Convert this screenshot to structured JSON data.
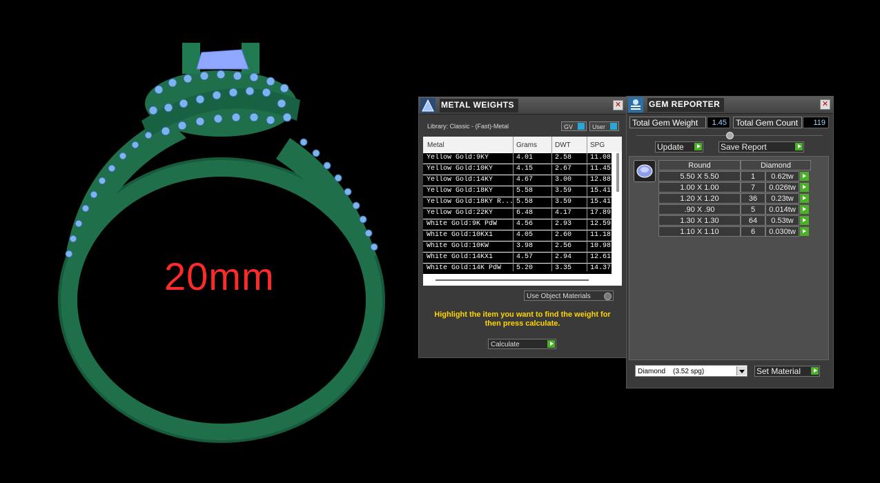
{
  "ring_view": {
    "size_label": "20mm"
  },
  "metal_weights": {
    "title": "METAL WEIGHTS",
    "library_label": "Library: Classic - (Fast)-Metal",
    "toggle_gv": "GV",
    "toggle_user": "User",
    "columns": [
      "Metal",
      "Grams",
      "DWT",
      "SPG"
    ],
    "rows": [
      [
        "Yellow Gold:9KY",
        "4.01",
        "2.58",
        "11.08"
      ],
      [
        "Yellow Gold:10KY",
        "4.15",
        "2.67",
        "11.45"
      ],
      [
        "Yellow Gold:14KY",
        "4.67",
        "3.00",
        "12.88"
      ],
      [
        "Yellow Gold:18KY",
        "5.58",
        "3.59",
        "15.41"
      ],
      [
        "Yellow Gold:18KY R...",
        "5.58",
        "3.59",
        "15.41"
      ],
      [
        "Yellow Gold:22KY",
        "6.48",
        "4.17",
        "17.89"
      ],
      [
        "White Gold:9K PdW",
        "4.56",
        "2.93",
        "12.59"
      ],
      [
        "White Gold:10KX1",
        "4.05",
        "2.60",
        "11.18"
      ],
      [
        "White Gold:10KW",
        "3.98",
        "2.56",
        "10.98"
      ],
      [
        "White Gold:14KX1",
        "4.57",
        "2.94",
        "12.61"
      ],
      [
        "White Gold:14K PdW",
        "5.20",
        "3.35",
        "14.37"
      ]
    ],
    "use_object_materials": "Use Object Materials",
    "hint": "Highlight the item you want to find the weight for then press calculate.",
    "calculate_label": "Calculate"
  },
  "gem_reporter": {
    "title": "GEM REPORTER",
    "total_weight_label": "Total Gem Weight",
    "total_weight_value": "1.45",
    "total_count_label": "Total Gem Count",
    "total_count_value": "119",
    "update_label": "Update",
    "save_report_label": "Save Report",
    "col_shape": "Round",
    "col_material": "Diamond",
    "gems": [
      {
        "size": "5.50 X 5.50",
        "count": "1",
        "weight": "0.62tw"
      },
      {
        "size": "1.00 X 1.00",
        "count": "7",
        "weight": "0.026tw"
      },
      {
        "size": "1.20 X 1.20",
        "count": "36",
        "weight": "0.23tw"
      },
      {
        "size": ".90 X .90",
        "count": "5",
        "weight": "0.014tw"
      },
      {
        "size": "1.30 X 1.30",
        "count": "64",
        "weight": "0.53tw"
      },
      {
        "size": "1.10 X 1.10",
        "count": "6",
        "weight": "0.030tw"
      }
    ],
    "material_select": "Diamond    (3.52 spg)",
    "set_material_label": "Set Material"
  },
  "colors": {
    "ring_metal": "#1f6f4a",
    "gems": "#7fb2f0",
    "size_label": "#ff2a2a",
    "hint": "#ffd400"
  }
}
